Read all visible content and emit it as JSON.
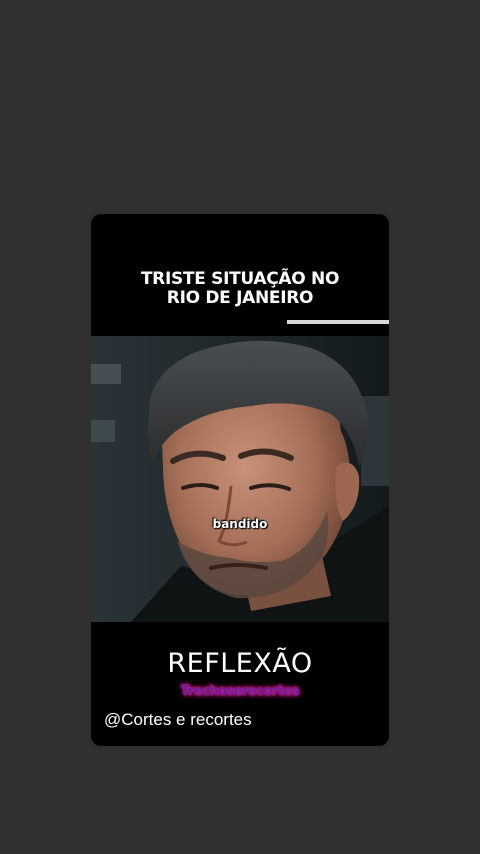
{
  "story": {
    "headline_line1": "TRISTE SITUAÇÃO NO",
    "headline_line2": "RIO DE JANEIRO",
    "progress_fraction": 1.0,
    "caption_word": "bandido",
    "subtitle": "REFLEXÃO",
    "watermark": "Trechoserecortes",
    "handle": "@Cortes e recortes"
  },
  "colors": {
    "background": "#303030",
    "card": "#000000",
    "watermark_glow": "#e0208a"
  }
}
